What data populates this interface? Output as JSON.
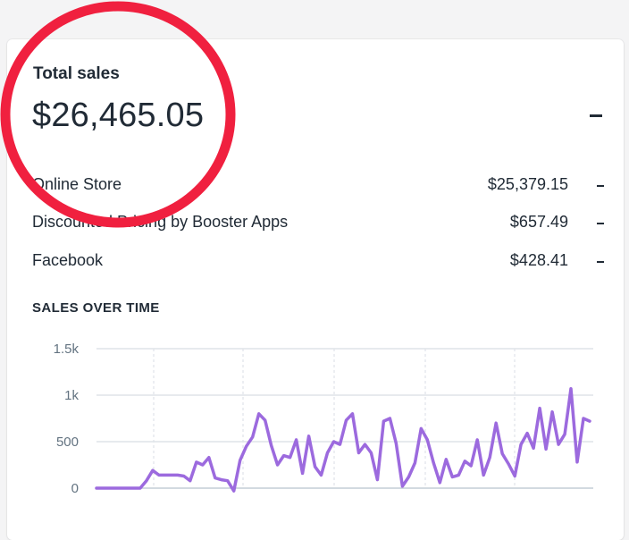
{
  "report": {
    "title": "Total sales",
    "total": "$26,465.05",
    "total_trend": "-",
    "channels": [
      {
        "name": "Online Store",
        "value": "$25,379.15",
        "trend": "-"
      },
      {
        "name": "Discounted Pricing by Booster Apps",
        "value": "$657.49",
        "trend": "-"
      },
      {
        "name": "Facebook",
        "value": "$428.41",
        "trend": "-"
      }
    ]
  },
  "sales_over_time": {
    "heading": "SALES OVER TIME"
  },
  "chart_data": {
    "type": "line",
    "y_ticks": [
      "1.5k",
      "1k",
      "500",
      "0"
    ],
    "ylim": [
      0,
      1500
    ],
    "grid": true,
    "series": [
      {
        "color": "#9c6ade",
        "values": [
          0,
          0,
          0,
          0,
          0,
          0,
          0,
          0,
          80,
          190,
          140,
          140,
          140,
          140,
          130,
          80,
          280,
          250,
          330,
          110,
          90,
          80,
          -30,
          300,
          450,
          550,
          800,
          730,
          460,
          250,
          350,
          330,
          520,
          160,
          560,
          230,
          140,
          380,
          500,
          470,
          730,
          800,
          380,
          470,
          380,
          90,
          720,
          750,
          480,
          20,
          120,
          270,
          640,
          520,
          270,
          60,
          310,
          120,
          140,
          290,
          240,
          520,
          140,
          330,
          700,
          370,
          260,
          130,
          470,
          590,
          430,
          860,
          420,
          820,
          470,
          580,
          1070,
          280,
          750,
          720
        ]
      }
    ]
  },
  "annotation": {
    "color": "#f0203f"
  }
}
